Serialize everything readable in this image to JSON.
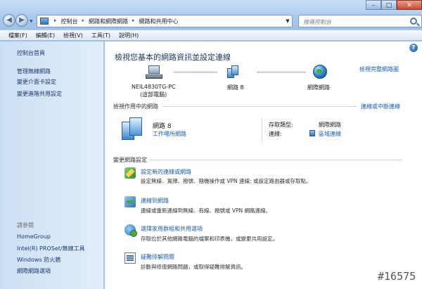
{
  "address": {
    "crumbs": [
      "控制台",
      "網路和網際網路",
      "網路和共用中心"
    ],
    "search_placeholder": "搜尋控制台"
  },
  "menu": [
    "檔案(F)",
    "編輯(E)",
    "檢視(V)",
    "工具(T)",
    "說明(H)"
  ],
  "sidebar": {
    "home": "控制台首頁",
    "links": [
      "管理無線網路",
      "變更介面卡設定",
      "變更進階共用設定"
    ],
    "see_also_header": "請參閱",
    "see_also": [
      "HomeGroup",
      "Intel(R) PROSet/無線工具",
      "Windows 防火牆",
      "網際網路選項"
    ]
  },
  "main": {
    "title": "檢視您基本的網路資訊並設定連線",
    "full_map_link": "檢視完整網路圖",
    "map": {
      "computer_name": "NEIL4830TG-PC",
      "computer_sub": "(這部電腦)",
      "network_name": "網路 8",
      "internet_label": "網際網路"
    },
    "active_section": {
      "title": "檢視作用中的網路",
      "connect_link": "連線或中斷連線",
      "network_name": "網路 8",
      "network_type": "工作場所網路",
      "access_type_label": "存取類型:",
      "access_type_value": "網際網路",
      "connection_label": "連線:",
      "connection_value": "區域連線"
    },
    "settings_section": {
      "title": "變更網路設定",
      "tasks": [
        {
          "link": "設定新的連線或網路",
          "desc": "設定無線、寬頻、撥號、隨機操作或 VPN 連線; 或設定路由器或存取點。"
        },
        {
          "link": "連線到網路",
          "desc": "連線或重新連線到無線、有線、撥號或 VPN 網路連線。"
        },
        {
          "link": "選擇家用群組和共用選項",
          "desc": "存取位於其他網路電腦的檔案和印表機，或變更共用設定。"
        },
        {
          "link": "疑難排解問題",
          "desc": "診斷與修復網路問題，或取得疑難排解資訊。"
        }
      ]
    }
  },
  "watermark": "#16575"
}
